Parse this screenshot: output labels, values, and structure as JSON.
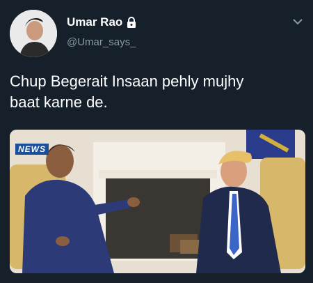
{
  "tweet": {
    "display_name": "Umar Rao",
    "handle": "@Umar_says_",
    "text_line1": "Chup Begerait Insaan pehly mujhy",
    "text_line2": "baat karne de."
  },
  "media": {
    "logo_text": "NEWS"
  },
  "icons": {
    "lock": "lock-icon",
    "chevron": "chevron-down-icon"
  },
  "colors": {
    "background": "#15202b",
    "secondary_text": "#8899a6"
  }
}
